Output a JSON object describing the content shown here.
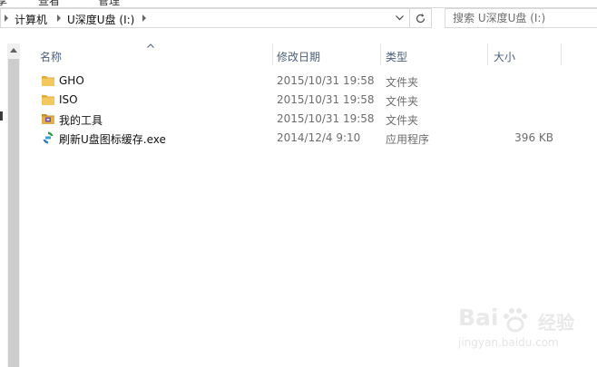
{
  "ribbon": {
    "tab1": "享",
    "tab2": "查看",
    "tab3": "管理"
  },
  "address": {
    "crumbs": [
      "计算机",
      "U深度U盘 (I:)"
    ]
  },
  "search": {
    "placeholder": "搜索 U深度U盘 (I:)"
  },
  "columns": {
    "name": "名称",
    "date": "修改日期",
    "type": "类型",
    "size": "大小"
  },
  "files": [
    {
      "name": "GHO",
      "date": "2015/10/31 19:58",
      "type": "文件夹",
      "size": "",
      "icon": "folder-icon"
    },
    {
      "name": "ISO",
      "date": "2015/10/31 19:58",
      "type": "文件夹",
      "size": "",
      "icon": "folder-icon"
    },
    {
      "name": "我的工具",
      "date": "2015/10/31 19:58",
      "type": "文件夹",
      "size": "",
      "icon": "toolbox-folder-icon"
    },
    {
      "name": "刷新U盘图标缓存.exe",
      "date": "2014/12/4 9:10",
      "type": "应用程序",
      "size": "396 KB",
      "icon": "exe-icon"
    }
  ],
  "watermark": {
    "brand": "Bai",
    "brand2": "经验",
    "url": "jingyan.baidu.com"
  },
  "colors": {
    "header_text": "#4c607a",
    "meta_text": "#6d6d6d",
    "folder": "#e8b74a"
  }
}
